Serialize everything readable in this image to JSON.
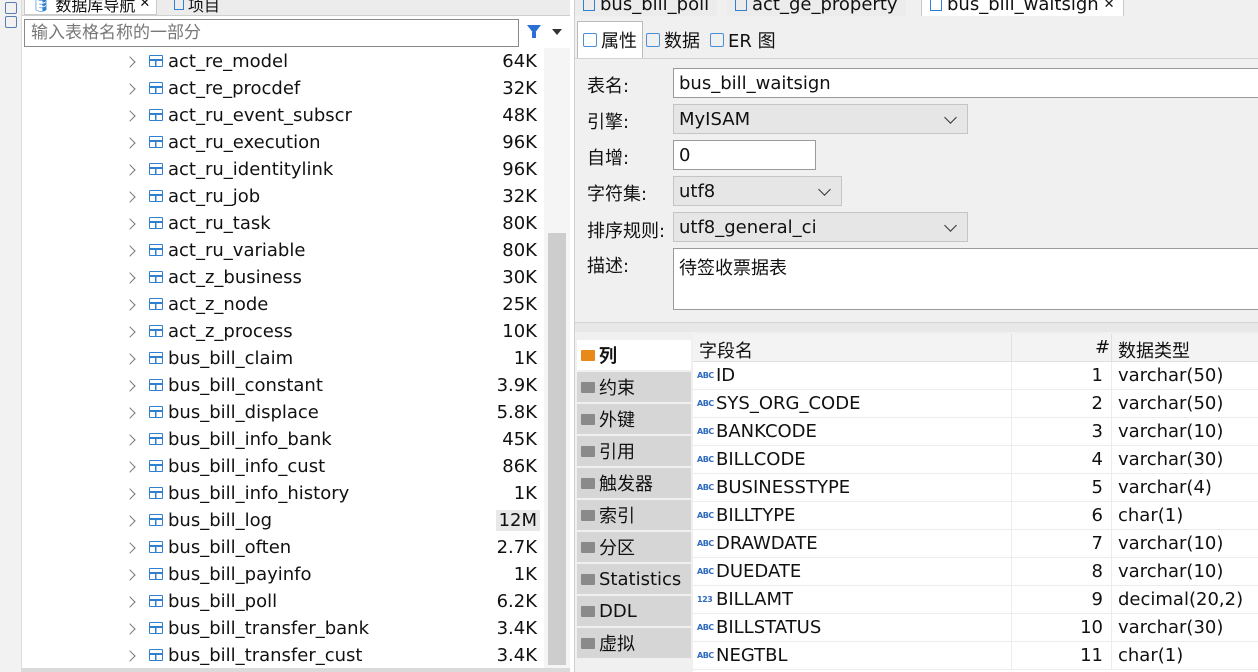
{
  "navigator": {
    "tabs": [
      {
        "label": "数据库导航",
        "close": "✕"
      },
      {
        "label": "项目"
      }
    ],
    "filter_placeholder": "输入表格名称的一部分",
    "tables": [
      {
        "name": "act_re_model",
        "size": "64K"
      },
      {
        "name": "act_re_procdef",
        "size": "32K"
      },
      {
        "name": "act_ru_event_subscr",
        "size": "48K"
      },
      {
        "name": "act_ru_execution",
        "size": "96K"
      },
      {
        "name": "act_ru_identitylink",
        "size": "96K"
      },
      {
        "name": "act_ru_job",
        "size": "32K"
      },
      {
        "name": "act_ru_task",
        "size": "80K"
      },
      {
        "name": "act_ru_variable",
        "size": "80K"
      },
      {
        "name": "act_z_business",
        "size": "30K"
      },
      {
        "name": "act_z_node",
        "size": "25K"
      },
      {
        "name": "act_z_process",
        "size": "10K"
      },
      {
        "name": "bus_bill_claim",
        "size": "1K"
      },
      {
        "name": "bus_bill_constant",
        "size": "3.9K"
      },
      {
        "name": "bus_bill_displace",
        "size": "5.8K"
      },
      {
        "name": "bus_bill_info_bank",
        "size": "45K"
      },
      {
        "name": "bus_bill_info_cust",
        "size": "86K"
      },
      {
        "name": "bus_bill_info_history",
        "size": "1K"
      },
      {
        "name": "bus_bill_log",
        "size": "12M"
      },
      {
        "name": "bus_bill_often",
        "size": "2.7K"
      },
      {
        "name": "bus_bill_payinfo",
        "size": "1K"
      },
      {
        "name": "bus_bill_poll",
        "size": "6.2K"
      },
      {
        "name": "bus_bill_transfer_bank",
        "size": "3.4K"
      },
      {
        "name": "bus_bill_transfer_cust",
        "size": "3.4K"
      }
    ]
  },
  "editor": {
    "tabs": [
      {
        "label": "bus_bill_poll"
      },
      {
        "label": "act_ge_property"
      },
      {
        "label": "bus_bill_waitsign",
        "close": "✕"
      }
    ],
    "subtabs": [
      {
        "label": "属性"
      },
      {
        "label": "数据"
      },
      {
        "label": "ER 图"
      }
    ],
    "props": {
      "name_label": "表名:",
      "name_value": "bus_bill_waitsign",
      "engine_label": "引擎:",
      "engine_value": "MyISAM",
      "autoinc_label": "自增:",
      "autoinc_value": "0",
      "charset_label": "字符集:",
      "charset_value": "utf8",
      "collation_label": "排序规则:",
      "collation_value": "utf8_general_ci",
      "desc_label": "描述:",
      "desc_value": "待签收票据表"
    },
    "side_tabs": [
      {
        "label": "列"
      },
      {
        "label": "约束"
      },
      {
        "label": "外键"
      },
      {
        "label": "引用"
      },
      {
        "label": "触发器"
      },
      {
        "label": "索引"
      },
      {
        "label": "分区"
      },
      {
        "label": "Statistics"
      },
      {
        "label": "DDL"
      },
      {
        "label": "虚拟"
      }
    ],
    "columns_header": {
      "name": "字段名",
      "num": "#",
      "type": "数据类型"
    },
    "columns": [
      {
        "icon": "ABC",
        "name": "ID",
        "num": "1",
        "type": "varchar(50)"
      },
      {
        "icon": "ABC",
        "name": "SYS_ORG_CODE",
        "num": "2",
        "type": "varchar(50)"
      },
      {
        "icon": "ABC",
        "name": "BANKCODE",
        "num": "3",
        "type": "varchar(10)"
      },
      {
        "icon": "ABC",
        "name": "BILLCODE",
        "num": "4",
        "type": "varchar(30)"
      },
      {
        "icon": "ABC",
        "name": "BUSINESSTYPE",
        "num": "5",
        "type": "varchar(4)"
      },
      {
        "icon": "ABC",
        "name": "BILLTYPE",
        "num": "6",
        "type": "char(1)"
      },
      {
        "icon": "ABC",
        "name": "DRAWDATE",
        "num": "7",
        "type": "varchar(10)"
      },
      {
        "icon": "ABC",
        "name": "DUEDATE",
        "num": "8",
        "type": "varchar(10)"
      },
      {
        "icon": "123",
        "name": "BILLAMT",
        "num": "9",
        "type": "decimal(20,2)"
      },
      {
        "icon": "ABC",
        "name": "BILLSTATUS",
        "num": "10",
        "type": "varchar(30)"
      },
      {
        "icon": "ABC",
        "name": "NEGTBL",
        "num": "11",
        "type": "char(1)"
      }
    ]
  }
}
